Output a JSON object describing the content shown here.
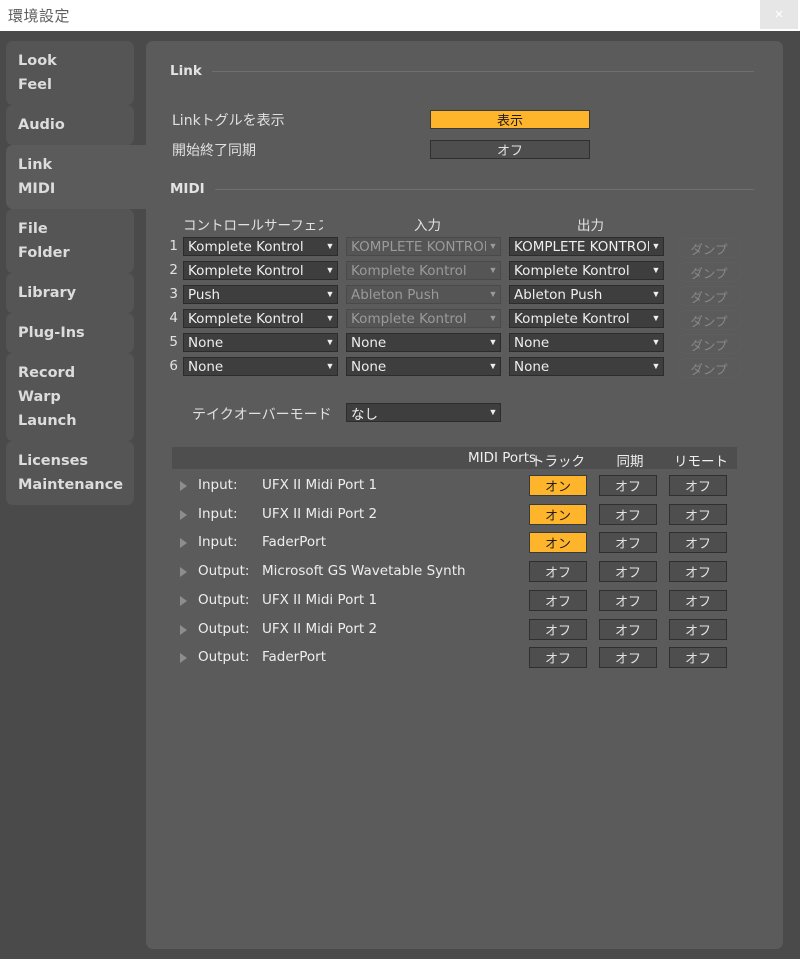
{
  "window": {
    "title": "環境設定",
    "close_icon": "close-icon",
    "close_glyph": "×"
  },
  "colors": {
    "accent": "#ffb52b",
    "panel": "#5b5b5b",
    "dialog_bg": "#4a4a4a",
    "control_bg": "#3e3e3e",
    "titlebar_bg": "#ffffff"
  },
  "sidebar": {
    "groups": [
      {
        "selected": false,
        "items": [
          "Look",
          "Feel"
        ]
      },
      {
        "selected": false,
        "items": [
          "Audio"
        ]
      },
      {
        "selected": true,
        "items": [
          "Link",
          "MIDI"
        ]
      },
      {
        "selected": false,
        "items": [
          "File",
          "Folder"
        ]
      },
      {
        "selected": false,
        "items": [
          "Library"
        ]
      },
      {
        "selected": false,
        "items": [
          "Plug-Ins"
        ]
      },
      {
        "selected": false,
        "items": [
          "Record",
          "Warp",
          "Launch"
        ]
      },
      {
        "selected": false,
        "items": [
          "Licenses",
          "Maintenance"
        ]
      }
    ]
  },
  "link_section": {
    "heading": "Link",
    "rows": [
      {
        "label": "Linkトグルを表示",
        "value": "表示",
        "on": true
      },
      {
        "label": "開始終了同期",
        "value": "オフ",
        "on": false
      }
    ]
  },
  "midi_section": {
    "heading": "MIDI",
    "columns": [
      "コントロールサーフェス",
      "入力",
      "出力"
    ],
    "rows": [
      {
        "index": "1",
        "surface": "Komplete Kontrol",
        "input": "KOMPLETE KONTROL",
        "input_disabled": true,
        "output": "KOMPLETE KONTROL",
        "dump": "ダンプ"
      },
      {
        "index": "2",
        "surface": "Komplete Kontrol",
        "input": "Komplete Kontrol",
        "input_disabled": true,
        "output": "Komplete Kontrol",
        "dump": "ダンプ"
      },
      {
        "index": "3",
        "surface": "Push",
        "input": "Ableton Push",
        "input_disabled": true,
        "output": "Ableton Push",
        "dump": "ダンプ"
      },
      {
        "index": "4",
        "surface": "Komplete Kontrol",
        "input": "Komplete Kontrol",
        "input_disabled": true,
        "output": "Komplete Kontrol",
        "dump": "ダンプ"
      },
      {
        "index": "5",
        "surface": "None",
        "input": "None",
        "input_disabled": false,
        "output": "None",
        "dump": "ダンプ"
      },
      {
        "index": "6",
        "surface": "None",
        "input": "None",
        "input_disabled": false,
        "output": "None",
        "dump": "ダンプ"
      }
    ],
    "takeover": {
      "label": "テイクオーバーモード",
      "value": "なし"
    }
  },
  "midi_ports": {
    "headers": {
      "name": "MIDI Ports",
      "track": "トラック",
      "sync": "同期",
      "remote": "リモート"
    },
    "rows": [
      {
        "direction": "Input:",
        "name": "UFX II Midi Port 1",
        "track": "オン",
        "track_on": true,
        "sync": "オフ",
        "sync_on": false,
        "remote": "オフ",
        "remote_on": false
      },
      {
        "direction": "Input:",
        "name": "UFX II Midi Port 2",
        "track": "オン",
        "track_on": true,
        "sync": "オフ",
        "sync_on": false,
        "remote": "オフ",
        "remote_on": false
      },
      {
        "direction": "Input:",
        "name": "FaderPort",
        "track": "オン",
        "track_on": true,
        "sync": "オフ",
        "sync_on": false,
        "remote": "オフ",
        "remote_on": false
      },
      {
        "direction": "Output:",
        "name": "Microsoft GS Wavetable Synth",
        "track": "オフ",
        "track_on": false,
        "sync": "オフ",
        "sync_on": false,
        "remote": "オフ",
        "remote_on": false
      },
      {
        "direction": "Output:",
        "name": "UFX II Midi Port 1",
        "track": "オフ",
        "track_on": false,
        "sync": "オフ",
        "sync_on": false,
        "remote": "オフ",
        "remote_on": false
      },
      {
        "direction": "Output:",
        "name": "UFX II Midi Port 2",
        "track": "オフ",
        "track_on": false,
        "sync": "オフ",
        "sync_on": false,
        "remote": "オフ",
        "remote_on": false
      },
      {
        "direction": "Output:",
        "name": "FaderPort",
        "track": "オフ",
        "track_on": false,
        "sync": "オフ",
        "sync_on": false,
        "remote": "オフ",
        "remote_on": false
      }
    ]
  }
}
